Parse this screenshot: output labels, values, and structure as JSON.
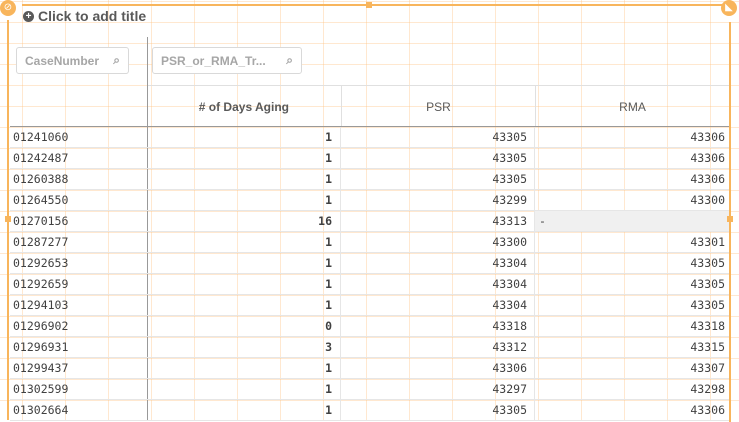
{
  "title": "Click to add title",
  "filters": [
    {
      "label": "CaseNumber",
      "icon": "search-icon"
    },
    {
      "label": "PSR_or_RMA_Tr...",
      "icon": "search-icon"
    }
  ],
  "columns": [
    "# of Days Aging",
    "PSR",
    "RMA"
  ],
  "accent": "#f8b55c",
  "rows": [
    [
      "01241060",
      "1",
      "43305",
      "43306"
    ],
    [
      "01242487",
      "1",
      "43305",
      "43306"
    ],
    [
      "01260388",
      "1",
      "43305",
      "43306"
    ],
    [
      "01264550",
      "1",
      "43299",
      "43300"
    ],
    [
      "01270156",
      "16",
      "43313",
      "-"
    ],
    [
      "01287277",
      "1",
      "43300",
      "43301"
    ],
    [
      "01292653",
      "1",
      "43304",
      "43305"
    ],
    [
      "01292659",
      "1",
      "43304",
      "43305"
    ],
    [
      "01294103",
      "1",
      "43304",
      "43305"
    ],
    [
      "01296902",
      "0",
      "43318",
      "43318"
    ],
    [
      "01296931",
      "3",
      "43312",
      "43315"
    ],
    [
      "01299437",
      "1",
      "43306",
      "43307"
    ],
    [
      "01302599",
      "1",
      "43297",
      "43298"
    ],
    [
      "01302664",
      "1",
      "43305",
      "43306"
    ]
  ]
}
